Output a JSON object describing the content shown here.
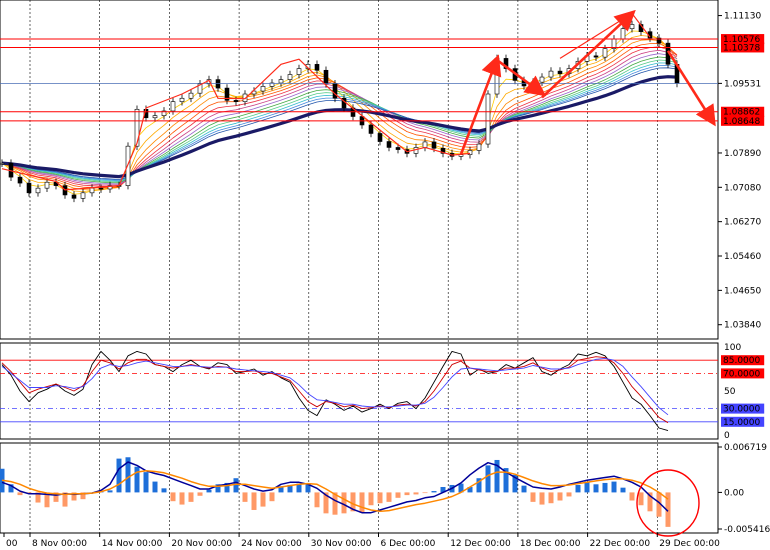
{
  "colors": {
    "background": "#ffffff",
    "grid": "#000000",
    "price_candles": "#000000",
    "ribbon_main": "#1a1a66",
    "resistance_lines": "#ff0000",
    "current_price_line": "#4a6fb5",
    "arrows": "#ff2a1a",
    "stoch_main": "#000000",
    "stoch_signal": "#cc0000",
    "stoch_ma": "#4444ff",
    "macd_pos_hist": "#1e6fd9",
    "macd_neg_hist": "#ff9966",
    "macd_line": "#000099",
    "macd_signal": "#ff8800",
    "highlight_circle": "#ff0000"
  },
  "chart_data": [
    {
      "type": "line",
      "panel": "price",
      "x_ticks": [
        "00",
        "8 Nov 00:00",
        "14 Nov 00:00",
        "20 Nov 00:00",
        "24 Nov 00:00",
        "30 Nov 00:00",
        "6 Dec 00:00",
        "12 Dec 00:00",
        "18 Dec 00:00",
        "22 Dec 00:00",
        "29 Dec 00:00"
      ],
      "y_ticks": [
        "1.11130",
        "1.09531",
        "1.07890",
        "1.07080",
        "1.06270",
        "1.05460",
        "1.04650",
        "1.03840"
      ],
      "ylim": [
        1.0355,
        1.1145
      ],
      "level_labels": [
        "1.10576",
        "1.10378",
        "1.08862",
        "1.08648"
      ],
      "levels": [
        1.10576,
        1.10378,
        1.08862,
        1.08648
      ],
      "current_price": 1.09531,
      "series": [
        {
          "values": [
            1.0765,
            1.0732,
            1.0718,
            1.0695,
            1.0706,
            1.072,
            1.0712,
            1.069,
            1.0682,
            1.0695,
            1.0706,
            1.0704,
            1.0712,
            1.0712,
            1.0805,
            1.0892,
            1.0872,
            1.0877,
            1.0888,
            1.091,
            1.0918,
            1.093,
            1.0952,
            1.0962,
            1.0942,
            1.0913,
            1.091,
            1.0928,
            1.0935,
            1.0946,
            1.0954,
            1.0962,
            1.0974,
            1.0988,
            1.0998,
            1.0984,
            1.0952,
            1.0918,
            1.0895,
            1.0875,
            1.0855,
            1.0835,
            1.0816,
            1.0802,
            1.0797,
            1.0788,
            1.0802,
            1.0815,
            1.08,
            1.0788,
            1.0781,
            1.0785,
            1.0795,
            1.081,
            1.0928,
            1.1012,
            1.0988,
            1.096,
            1.0947,
            1.0956,
            1.0968,
            1.0982,
            1.0976,
            1.0988,
            1.1005,
            1.1018,
            1.1015,
            1.1035,
            1.1058,
            1.1082,
            1.1092,
            1.1075,
            1.106,
            1.1048,
            1.0998,
            1.0953
          ]
        }
      ]
    },
    {
      "type": "line",
      "panel": "stochastic",
      "scale_labels": [
        "100",
        "50",
        "0"
      ],
      "level_labels": [
        "85.0000",
        "70.0000",
        "30.0000",
        "15.0000"
      ],
      "levels": [
        85,
        70,
        30,
        15
      ],
      "ylim": [
        0,
        100
      ],
      "series": [
        {
          "values": [
            80,
            68,
            50,
            38,
            48,
            52,
            58,
            50,
            45,
            52,
            80,
            95,
            85,
            72,
            90,
            95,
            92,
            80,
            78,
            72,
            80,
            85,
            78,
            75,
            82,
            80,
            70,
            72,
            75,
            68,
            72,
            65,
            60,
            42,
            28,
            22,
            40,
            35,
            28,
            33,
            26,
            30,
            35,
            30,
            36,
            38,
            30,
            42,
            60,
            78,
            95,
            92,
            68,
            75,
            70,
            72,
            80,
            76,
            82,
            88,
            72,
            68,
            75,
            80,
            92,
            90,
            94,
            90,
            78,
            60,
            42,
            35,
            22,
            8,
            5
          ]
        },
        {
          "values": [
            82,
            72,
            60,
            48,
            52,
            55,
            58,
            54,
            50,
            56,
            72,
            85,
            82,
            75,
            82,
            86,
            86,
            80,
            78,
            76,
            78,
            80,
            78,
            76,
            78,
            77,
            72,
            72,
            73,
            70,
            70,
            66,
            62,
            50,
            38,
            32,
            38,
            36,
            32,
            34,
            30,
            31,
            33,
            31,
            34,
            35,
            33,
            38,
            50,
            65,
            80,
            84,
            76,
            74,
            72,
            72,
            76,
            76,
            78,
            82,
            76,
            72,
            74,
            77,
            85,
            87,
            89,
            88,
            82,
            70,
            55,
            44,
            32,
            20,
            14
          ]
        },
        {
          "values": [
            78,
            70,
            62,
            54,
            54,
            54,
            56,
            55,
            53,
            55,
            64,
            76,
            80,
            78,
            79,
            82,
            84,
            82,
            80,
            78,
            78,
            79,
            78,
            77,
            77,
            77,
            75,
            74,
            73,
            72,
            71,
            68,
            65,
            57,
            47,
            40,
            39,
            37,
            35,
            35,
            33,
            32,
            32,
            32,
            33,
            34,
            34,
            36,
            43,
            54,
            66,
            75,
            76,
            75,
            74,
            73,
            74,
            75,
            76,
            79,
            77,
            75,
            75,
            76,
            80,
            83,
            86,
            87,
            85,
            78,
            66,
            55,
            43,
            31,
            23
          ]
        }
      ]
    },
    {
      "type": "bar",
      "panel": "macd",
      "scale_labels": [
        "0.006719",
        "0.00",
        "-0.005416"
      ],
      "ylim": [
        -0.005416,
        0.006719
      ],
      "histogram": [
        0.0035,
        0.0012,
        -0.0004,
        -0.0002,
        -0.0015,
        -0.0022,
        -0.0014,
        -0.0021,
        -0.0012,
        -0.001,
        0.0,
        0.0002,
        0.0003,
        0.005,
        0.0052,
        0.0038,
        0.003,
        0.0016,
        0.0006,
        -0.0013,
        -0.0018,
        -0.0014,
        -0.0005,
        0.0004,
        0.0012,
        0.0014,
        0.0021,
        -0.0014,
        -0.0026,
        -0.0021,
        -0.0013,
        0.0009,
        0.0011,
        0.0013,
        0.0012,
        -0.0022,
        -0.0031,
        -0.0033,
        -0.0031,
        -0.0028,
        -0.003,
        -0.0019,
        -0.0016,
        -0.0014,
        -0.0008,
        -0.0004,
        -0.0003,
        -0.0001,
        0.0002,
        0.0008,
        0.0011,
        0.0013,
        0.0008,
        0.0021,
        0.004,
        0.0048,
        0.0036,
        0.0026,
        0.001,
        -0.0014,
        -0.0018,
        -0.0016,
        -0.0012,
        -0.0006,
        0.0011,
        0.0016,
        0.0012,
        0.0014,
        0.0016,
        0.0007,
        -0.0012,
        -0.0019,
        -0.0028,
        -0.0036,
        -0.0051
      ],
      "series": [
        {
          "values": [
            0.0015,
            0.001,
            0.0002,
            -0.0002,
            -0.0002,
            -0.0003,
            -0.0004,
            -0.0002,
            -0.0003,
            -0.0002,
            -0.0001,
            0.0003,
            0.0012,
            0.0035,
            0.0045,
            0.004,
            0.0032,
            0.0028,
            0.0025,
            0.002,
            0.0015,
            0.001,
            0.0005,
            0.0005,
            0.001,
            0.0012,
            0.0015,
            0.001,
            0.0005,
            0.0002,
            0.0004,
            0.0012,
            0.0015,
            0.0015,
            0.0012,
            0.0006,
            -0.0004,
            -0.0012,
            -0.0018,
            -0.0025,
            -0.003,
            -0.003,
            -0.0026,
            -0.0022,
            -0.0018,
            -0.0014,
            -0.0012,
            -0.0008,
            -0.0006,
            0.0,
            0.0006,
            0.0014,
            0.0026,
            0.0036,
            0.0044,
            0.004,
            0.003,
            0.0022,
            0.0015,
            0.0008,
            0.0006,
            0.0005,
            0.0008,
            0.0012,
            0.0015,
            0.0018,
            0.002,
            0.0022,
            0.0024,
            0.002,
            0.0015,
            0.0008,
            -0.0005,
            -0.0015,
            -0.0028
          ]
        },
        {
          "values": [
            0.0018,
            0.0016,
            0.0012,
            0.0006,
            0.0002,
            -0.0001,
            -0.0002,
            -0.0003,
            -0.0002,
            -0.0002,
            -0.0001,
            0.0001,
            0.0005,
            0.0012,
            0.0022,
            0.003,
            0.0032,
            0.0031,
            0.0029,
            0.0025,
            0.0021,
            0.0016,
            0.0012,
            0.0009,
            0.0009,
            0.001,
            0.0012,
            0.0012,
            0.001,
            0.0008,
            0.0006,
            0.0008,
            0.001,
            0.0012,
            0.0013,
            0.0012,
            0.0005,
            -0.0003,
            -0.001,
            -0.0017,
            -0.0022,
            -0.0026,
            -0.0028,
            -0.0027,
            -0.0024,
            -0.0021,
            -0.0018,
            -0.0016,
            -0.0013,
            -0.001,
            -0.0006,
            0.0,
            0.0008,
            0.0016,
            0.0025,
            0.003,
            0.003,
            0.0027,
            0.0022,
            0.0017,
            0.0013,
            0.001,
            0.001,
            0.0011,
            0.0013,
            0.0015,
            0.0017,
            0.0019,
            0.002,
            0.002,
            0.0018,
            0.0014,
            0.0008,
            0.0,
            -0.001
          ]
        }
      ]
    }
  ]
}
